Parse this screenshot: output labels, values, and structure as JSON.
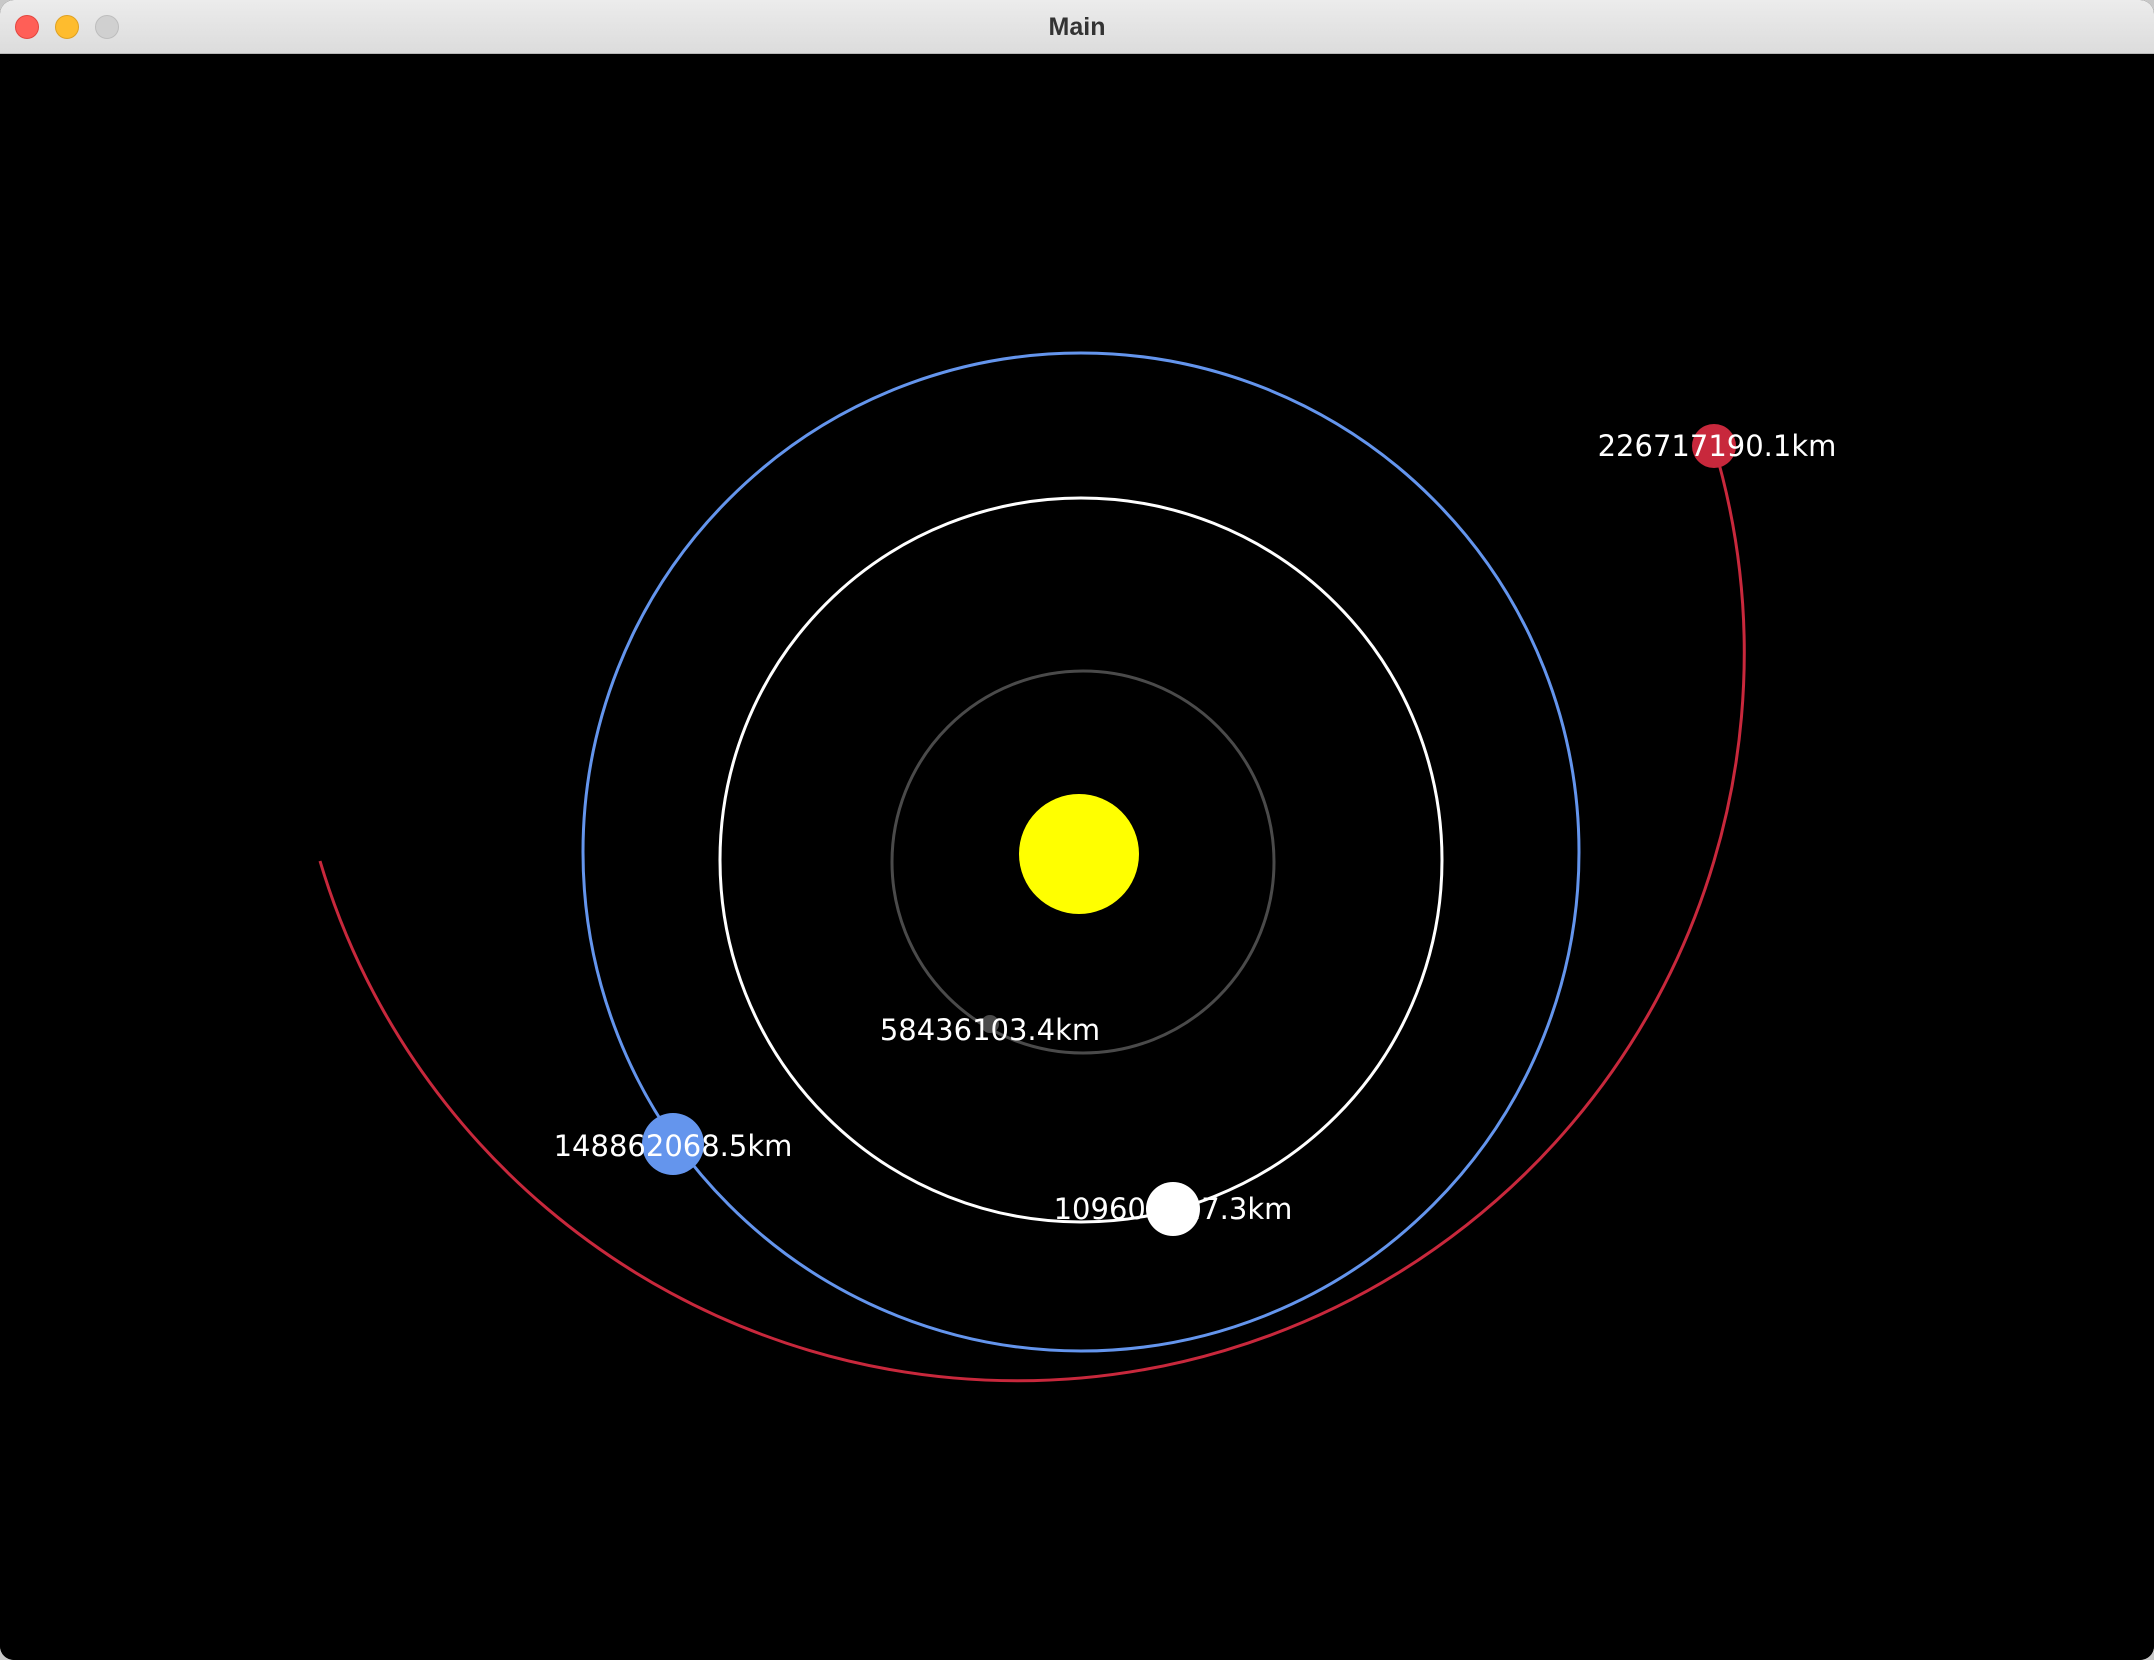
{
  "window": {
    "title": "Main"
  },
  "colors": {
    "sun": "#ffff00",
    "mercury": "#4a4a4a",
    "venus": "#ffffff",
    "earth": "#6495ed",
    "mars": "#c8283c",
    "label": "#ffffff",
    "background": "#000000"
  },
  "bodies": {
    "sun": {
      "color_name": "yellow"
    },
    "mercury": {
      "distance_label": "58436103.4km",
      "color_name": "gray"
    },
    "venus": {
      "distance_label": "109601117.3km",
      "color_name": "white"
    },
    "earth": {
      "distance_label": "148862068.5km",
      "color_name": "cornflower-blue"
    },
    "mars": {
      "distance_label": "226717190.1km",
      "color_name": "red"
    }
  }
}
